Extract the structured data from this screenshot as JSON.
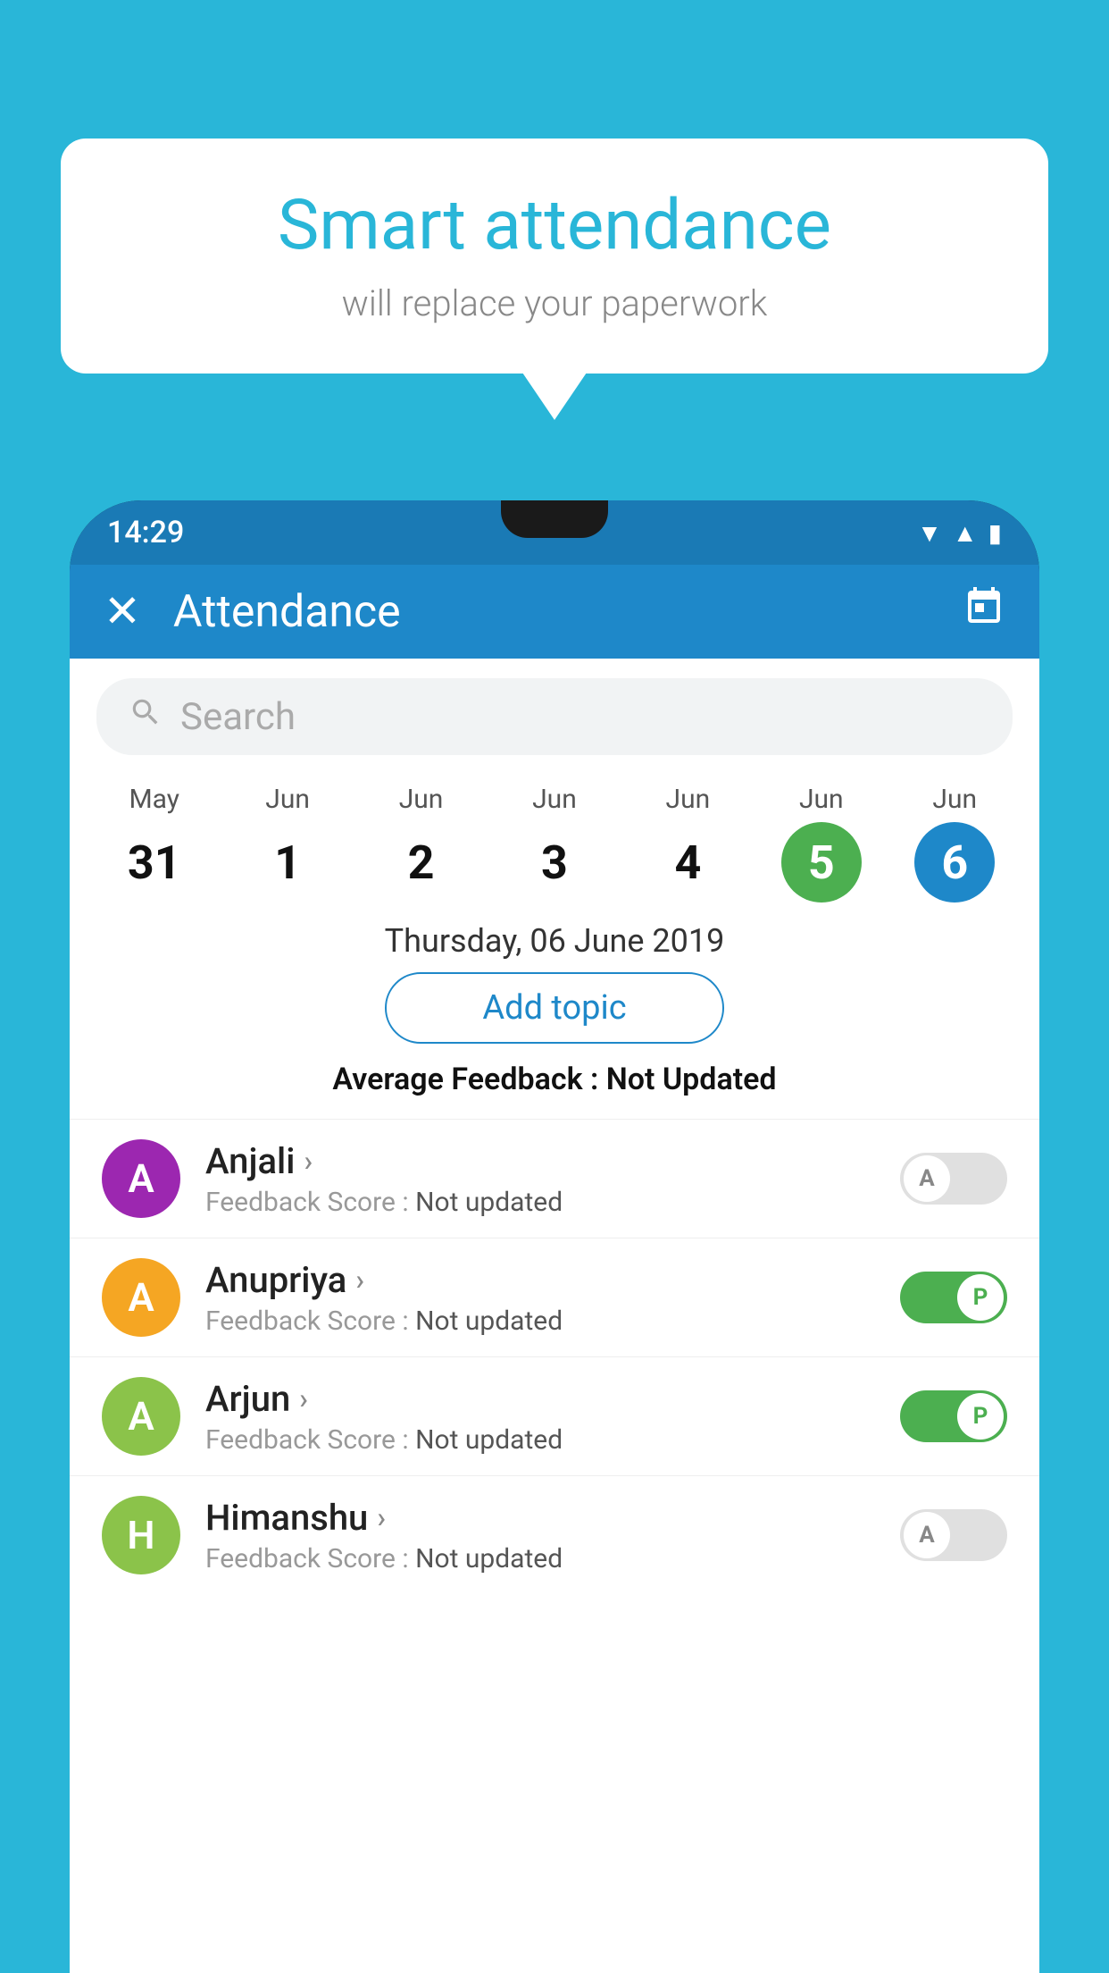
{
  "background_color": "#29b6d8",
  "bubble": {
    "title": "Smart attendance",
    "subtitle": "will replace your paperwork"
  },
  "phone": {
    "status_bar": {
      "time": "14:29",
      "wifi_icon": "▼",
      "signal_icon": "▲",
      "battery_icon": "▮"
    },
    "app_bar": {
      "title": "Attendance",
      "close_label": "✕",
      "calendar_label": "📅"
    },
    "search": {
      "placeholder": "Search"
    },
    "calendar": {
      "days": [
        {
          "month": "May",
          "date": "31",
          "style": "normal"
        },
        {
          "month": "Jun",
          "date": "1",
          "style": "normal"
        },
        {
          "month": "Jun",
          "date": "2",
          "style": "normal"
        },
        {
          "month": "Jun",
          "date": "3",
          "style": "normal"
        },
        {
          "month": "Jun",
          "date": "4",
          "style": "normal"
        },
        {
          "month": "Jun",
          "date": "5",
          "style": "today"
        },
        {
          "month": "Jun",
          "date": "6",
          "style": "selected"
        }
      ]
    },
    "selected_date": "Thursday, 06 June 2019",
    "add_topic_label": "Add topic",
    "avg_feedback_label": "Average Feedback :",
    "avg_feedback_value": "Not Updated",
    "students": [
      {
        "name": "Anjali",
        "avatar_letter": "A",
        "avatar_color": "#9c27b0",
        "feedback_label": "Feedback Score :",
        "feedback_value": "Not updated",
        "toggle_state": "off",
        "toggle_label": "A"
      },
      {
        "name": "Anupriya",
        "avatar_letter": "A",
        "avatar_color": "#f5a623",
        "feedback_label": "Feedback Score :",
        "feedback_value": "Not updated",
        "toggle_state": "on",
        "toggle_label": "P"
      },
      {
        "name": "Arjun",
        "avatar_letter": "A",
        "avatar_color": "#8bc34a",
        "feedback_label": "Feedback Score :",
        "feedback_value": "Not updated",
        "toggle_state": "on",
        "toggle_label": "P"
      },
      {
        "name": "Himanshu",
        "avatar_letter": "H",
        "avatar_color": "#8bc34a",
        "feedback_label": "Feedback Score :",
        "feedback_value": "Not updated",
        "toggle_state": "off",
        "toggle_label": "A"
      }
    ]
  }
}
